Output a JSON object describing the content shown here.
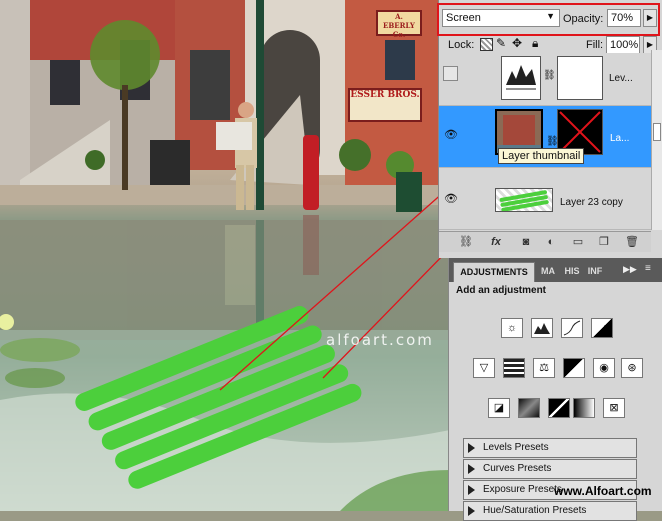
{
  "colors": {
    "selection_blue": "#3399ff",
    "annotation_red": "#e0141b",
    "panel_gray": "#d6d6d6",
    "raft_green": "#4ccf3c"
  },
  "blend": {
    "mode": "Screen",
    "opacity_label": "Opacity:",
    "opacity_value": "70%"
  },
  "lock_row": {
    "lock_label": "Lock:",
    "fill_label": "Fill:",
    "fill_value": "100%"
  },
  "layers": [
    {
      "name": "Lev...",
      "visible": false,
      "selected": false,
      "kind": "levels-adjustment"
    },
    {
      "name": "La...",
      "visible": true,
      "selected": true,
      "kind": "image-with-mask"
    },
    {
      "name": "Layer 23 copy",
      "visible": true,
      "selected": false,
      "kind": "green-raft"
    }
  ],
  "tooltip": "Layer thumbnail",
  "layer_tools": [
    "link-icon",
    "fx-icon",
    "mask-icon",
    "adjustment-icon",
    "folder-icon",
    "new-layer-icon",
    "trash-icon"
  ],
  "adjustments_panel": {
    "tabs": [
      "ADJUSTMENTS",
      "MA",
      "HIS",
      "INF"
    ],
    "heading": "Add an adjustment",
    "icon_rows": [
      [
        "brightness-icon",
        "levels-icon",
        "curves-icon",
        "exposure-icon"
      ],
      [
        "vibrance-icon",
        "hue-saturation-icon",
        "color-balance-icon",
        "black-white-icon",
        "photo-filter-icon",
        "channel-mixer-icon"
      ],
      [
        "invert-icon",
        "posterize-icon",
        "threshold-icon",
        "gradient-map-icon",
        "selective-color-icon"
      ]
    ],
    "presets": [
      "Levels Presets",
      "Curves Presets",
      "Exposure Presets",
      "Hue/Saturation Presets"
    ]
  },
  "scene_text": {
    "watermark": "alfoart.com",
    "site_watermark": "www.Alfoart.com",
    "sign_top": "A. EBERLY Co.",
    "sign_esser": "ESSER BROS."
  }
}
